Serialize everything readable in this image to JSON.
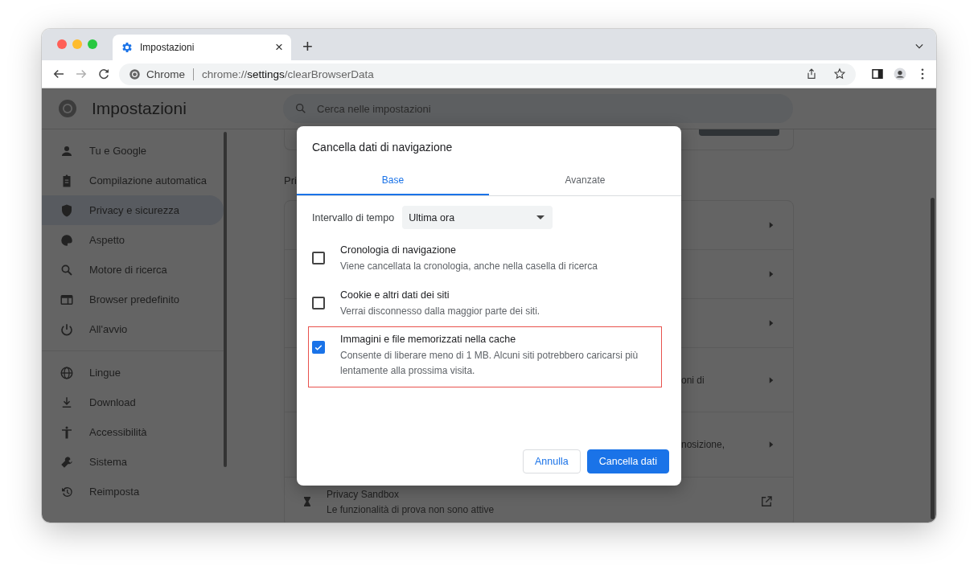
{
  "browser": {
    "tab": {
      "title": "Impostazioni",
      "close": "×"
    },
    "new_tab": "+",
    "omnibox": {
      "site": "Chrome",
      "url": "chrome://**settings**/clearBrowserData"
    }
  },
  "settings": {
    "title": "Impostazioni",
    "search": {
      "placeholder": "Cerca nelle impostazioni"
    },
    "sidebar": {
      "sections": [
        {
          "items": [
            {
              "label": "Tu e Google",
              "selected": false
            },
            {
              "label": "Compilazione automatica",
              "selected": false
            },
            {
              "label": "Privacy e sicurezza",
              "selected": true
            },
            {
              "label": "Aspetto",
              "selected": false
            },
            {
              "label": "Motore di ricerca",
              "selected": false
            },
            {
              "label": "Browser predefinito",
              "selected": false
            },
            {
              "label": "All'avvio",
              "selected": false
            }
          ]
        },
        {
          "items": [
            {
              "label": "Lingue",
              "selected": false
            },
            {
              "label": "Download",
              "selected": false
            },
            {
              "label": "Accessibilità",
              "selected": false
            },
            {
              "label": "Sistema",
              "selected": false
            },
            {
              "label": "Reimposta",
              "selected": false
            }
          ]
        }
      ]
    },
    "section_heading": "Pri",
    "rows": [
      {
        "kind": "arrow"
      },
      {
        "kind": "arrow"
      },
      {
        "kind": "arrow"
      },
      {
        "kind": "arrow",
        "fragment": "oni di"
      },
      {
        "kind": "arrow",
        "fragment": "nosizione,"
      },
      {
        "kind": "external",
        "title": "Privacy Sandbox",
        "subtitle": "Le funzionalità di prova non sono attive"
      }
    ]
  },
  "dialog": {
    "title": "Cancella dati di navigazione",
    "tabs": [
      {
        "label": "Base",
        "selected": true
      },
      {
        "label": "Avanzate",
        "selected": false
      }
    ],
    "time_range": {
      "label": "Intervallo di tempo",
      "value": "Ultima ora"
    },
    "options": [
      {
        "title": "Cronologia di navigazione",
        "description": "Viene cancellata la cronologia, anche nella casella di ricerca",
        "checked": false,
        "highlighted": false
      },
      {
        "title": "Cookie e altri dati dei siti",
        "description": "Verrai disconnesso dalla maggior parte dei siti.",
        "checked": false,
        "highlighted": false
      },
      {
        "title": "Immagini e file memorizzati nella cache",
        "description": "Consente di liberare meno di 1 MB. Alcuni siti potrebbero caricarsi più lentamente alla prossima visita.",
        "checked": true,
        "highlighted": true
      }
    ],
    "buttons": [
      {
        "label": "Annulla",
        "kind": "secondary"
      },
      {
        "label": "Cancella dati",
        "kind": "primary"
      }
    ]
  }
}
